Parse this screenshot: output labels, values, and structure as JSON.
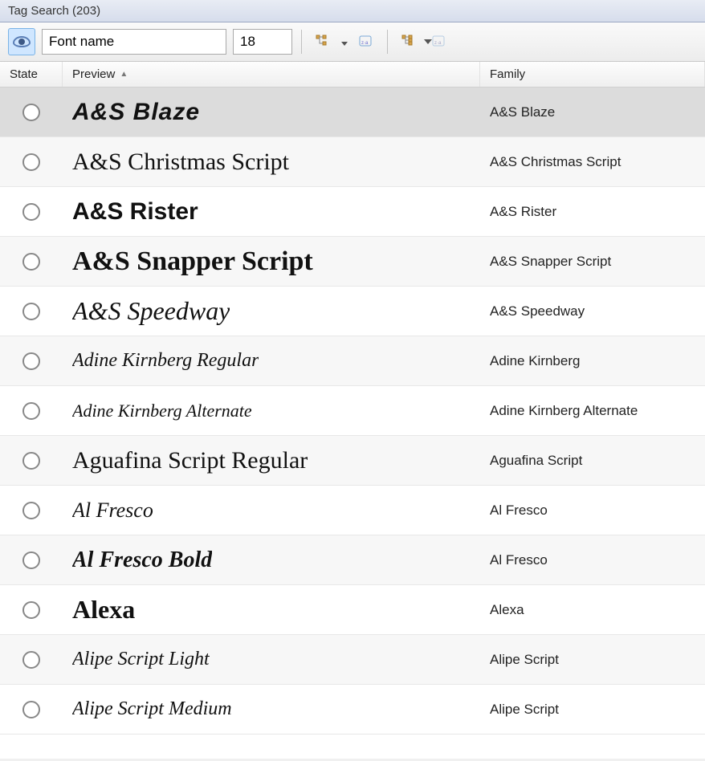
{
  "titlebar": {
    "text": "Tag Search (203)"
  },
  "toolbar": {
    "font_name_value": "Font name",
    "size_value": "18"
  },
  "columns": {
    "state": "State",
    "preview": "Preview",
    "family": "Family"
  },
  "rows": [
    {
      "preview": "A&S Blaze",
      "family": "A&S Blaze",
      "cls": "pf-blaze",
      "selected": true
    },
    {
      "preview": "A&S Christmas Script",
      "family": "A&S Christmas Script",
      "cls": "pf-christmas",
      "selected": false
    },
    {
      "preview": "A&S Rister",
      "family": "A&S Rister",
      "cls": "pf-rister",
      "selected": false
    },
    {
      "preview": "A&S Snapper Script",
      "family": "A&S Snapper Script",
      "cls": "pf-snapper",
      "selected": false
    },
    {
      "preview": "A&S Speedway",
      "family": "A&S Speedway",
      "cls": "pf-speedway",
      "selected": false
    },
    {
      "preview": "Adine Kirnberg Regular",
      "family": "Adine Kirnberg",
      "cls": "pf-adine",
      "selected": false
    },
    {
      "preview": "Adine Kirnberg Alternate",
      "family": "Adine Kirnberg Alternate",
      "cls": "pf-adine-alt",
      "selected": false
    },
    {
      "preview": "Aguafina Script Regular",
      "family": "Aguafina Script",
      "cls": "pf-aguafina",
      "selected": false
    },
    {
      "preview": "Al Fresco",
      "family": "Al Fresco",
      "cls": "pf-alfresco",
      "selected": false
    },
    {
      "preview": "Al Fresco Bold",
      "family": "Al Fresco",
      "cls": "pf-alfresco-bold",
      "selected": false
    },
    {
      "preview": "Alexa",
      "family": "Alexa",
      "cls": "pf-alexa",
      "selected": false
    },
    {
      "preview": "Alipe Script Light",
      "family": "Alipe Script",
      "cls": "pf-alipe-light",
      "selected": false
    },
    {
      "preview": "Alipe Script Medium",
      "family": "Alipe Script",
      "cls": "pf-alipe-medium",
      "selected": false
    }
  ]
}
